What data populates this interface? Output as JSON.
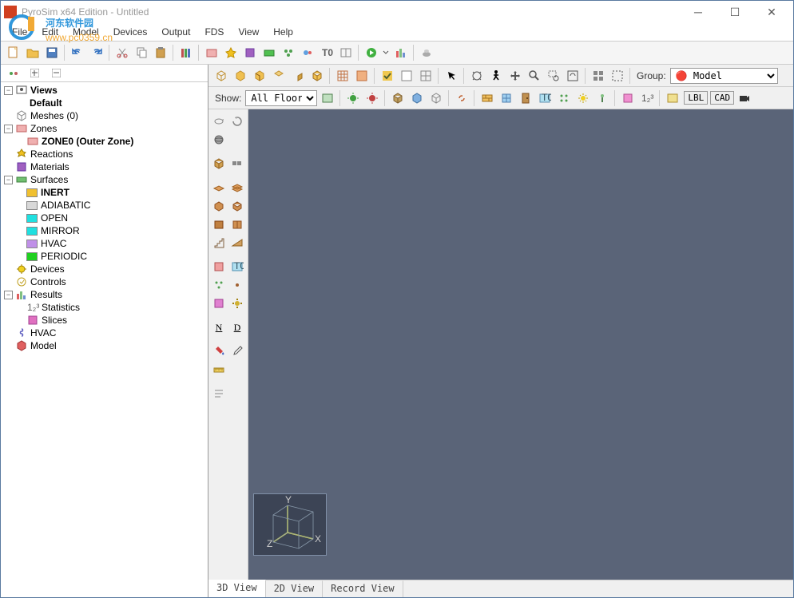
{
  "title": "PyroSim x64 Edition - Untitled",
  "watermark_text": "河东软件园",
  "watermark_url": "www.pc0359.cn",
  "menu": [
    "File",
    "Edit",
    "Model",
    "Devices",
    "Output",
    "FDS",
    "View",
    "Help"
  ],
  "show_label": "Show:",
  "floors_options": [
    "All Floors"
  ],
  "floors_selected": "All Floors",
  "group_label": "Group:",
  "group_options": [
    "Model"
  ],
  "group_selected": "Model",
  "cad_buttons": [
    "LBL",
    "CAD"
  ],
  "view_tabs": [
    "3D View",
    "2D View",
    "Record View"
  ],
  "active_tab": 0,
  "tree": {
    "views": {
      "label": "Views",
      "default": "Default"
    },
    "meshes": "Meshes (0)",
    "zones": {
      "label": "Zones",
      "zone0": "ZONE0 (Outer Zone)"
    },
    "reactions": "Reactions",
    "materials": "Materials",
    "surfaces": {
      "label": "Surfaces",
      "items": [
        {
          "name": "INERT",
          "color": "#f0c030"
        },
        {
          "name": "ADIABATIC",
          "color": "#d8d8d8"
        },
        {
          "name": "OPEN",
          "color": "#20e0e0"
        },
        {
          "name": "MIRROR",
          "color": "#20e0e0"
        },
        {
          "name": "HVAC",
          "color": "#c090e8"
        },
        {
          "name": "PERIODIC",
          "color": "#20d020"
        }
      ]
    },
    "devices": "Devices",
    "controls": "Controls",
    "results": {
      "label": "Results",
      "stats": "Statistics",
      "slices": "Slices"
    },
    "hvac": "HVAC",
    "model": "Model"
  },
  "axis_labels": {
    "x": "X",
    "y": "Y",
    "z": "Z"
  }
}
